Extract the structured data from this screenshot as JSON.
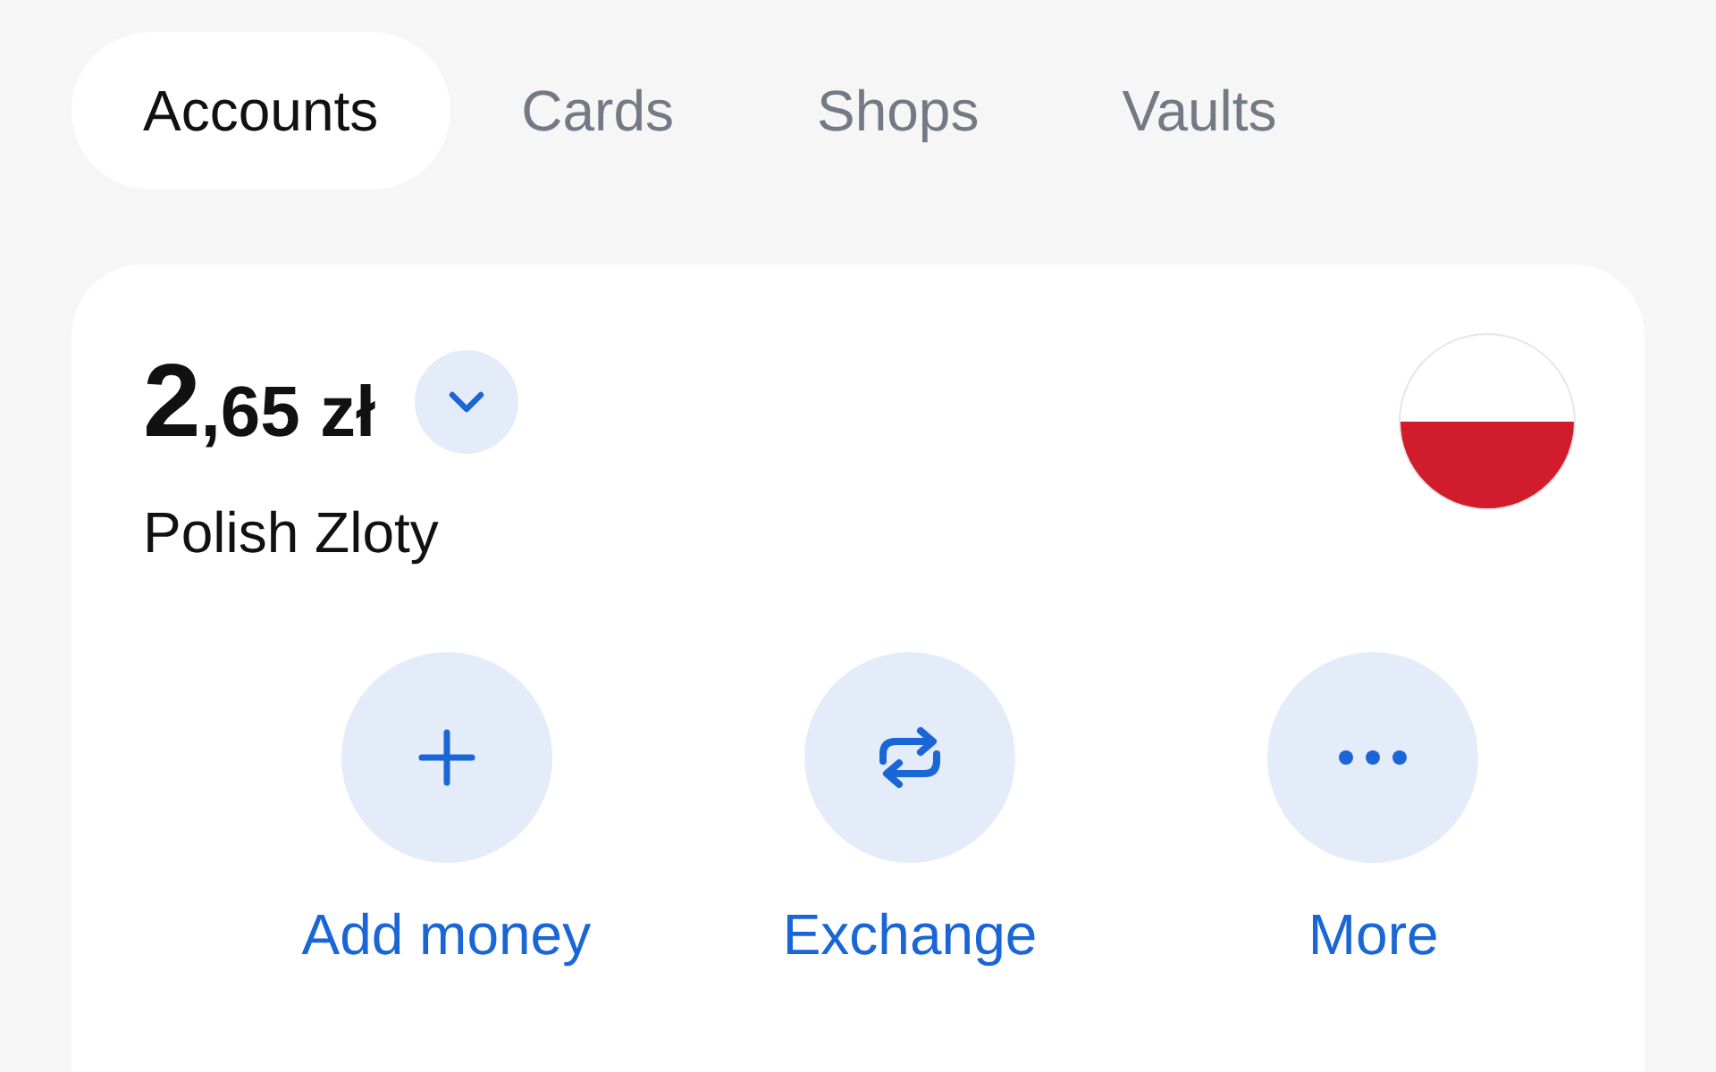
{
  "tabs": [
    {
      "label": "Accounts",
      "selected": true
    },
    {
      "label": "Cards",
      "selected": false
    },
    {
      "label": "Shops",
      "selected": false
    },
    {
      "label": "Vaults",
      "selected": false
    }
  ],
  "account": {
    "balance_integer": "2",
    "balance_fraction": ",65 zł",
    "currency_name": "Polish Zloty",
    "actions": [
      {
        "kind": "add",
        "label": "Add money"
      },
      {
        "kind": "exchange",
        "label": "Exchange"
      },
      {
        "kind": "more",
        "label": "More"
      }
    ]
  }
}
